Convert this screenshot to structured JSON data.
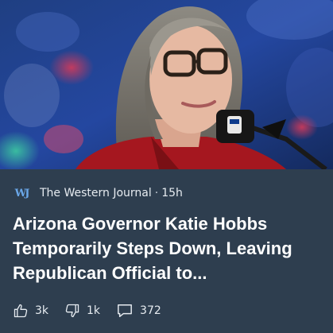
{
  "article": {
    "source_logo": "WJ",
    "source_name": "The Western Journal",
    "separator": "·",
    "time_ago": "15h",
    "headline": "Arizona Governor Katie Hobbs Temporarily Steps Down, Leaving Republican Official to..."
  },
  "actions": {
    "like_count": "3k",
    "dislike_count": "1k",
    "comment_count": "372"
  },
  "icons": {
    "like": "thumbs-up-icon",
    "dislike": "thumbs-down-icon",
    "comment": "comment-icon"
  },
  "colors": {
    "card_background": "#2e3e4f",
    "logo_accent": "#6aa7e8",
    "text_primary": "#ffffff"
  }
}
